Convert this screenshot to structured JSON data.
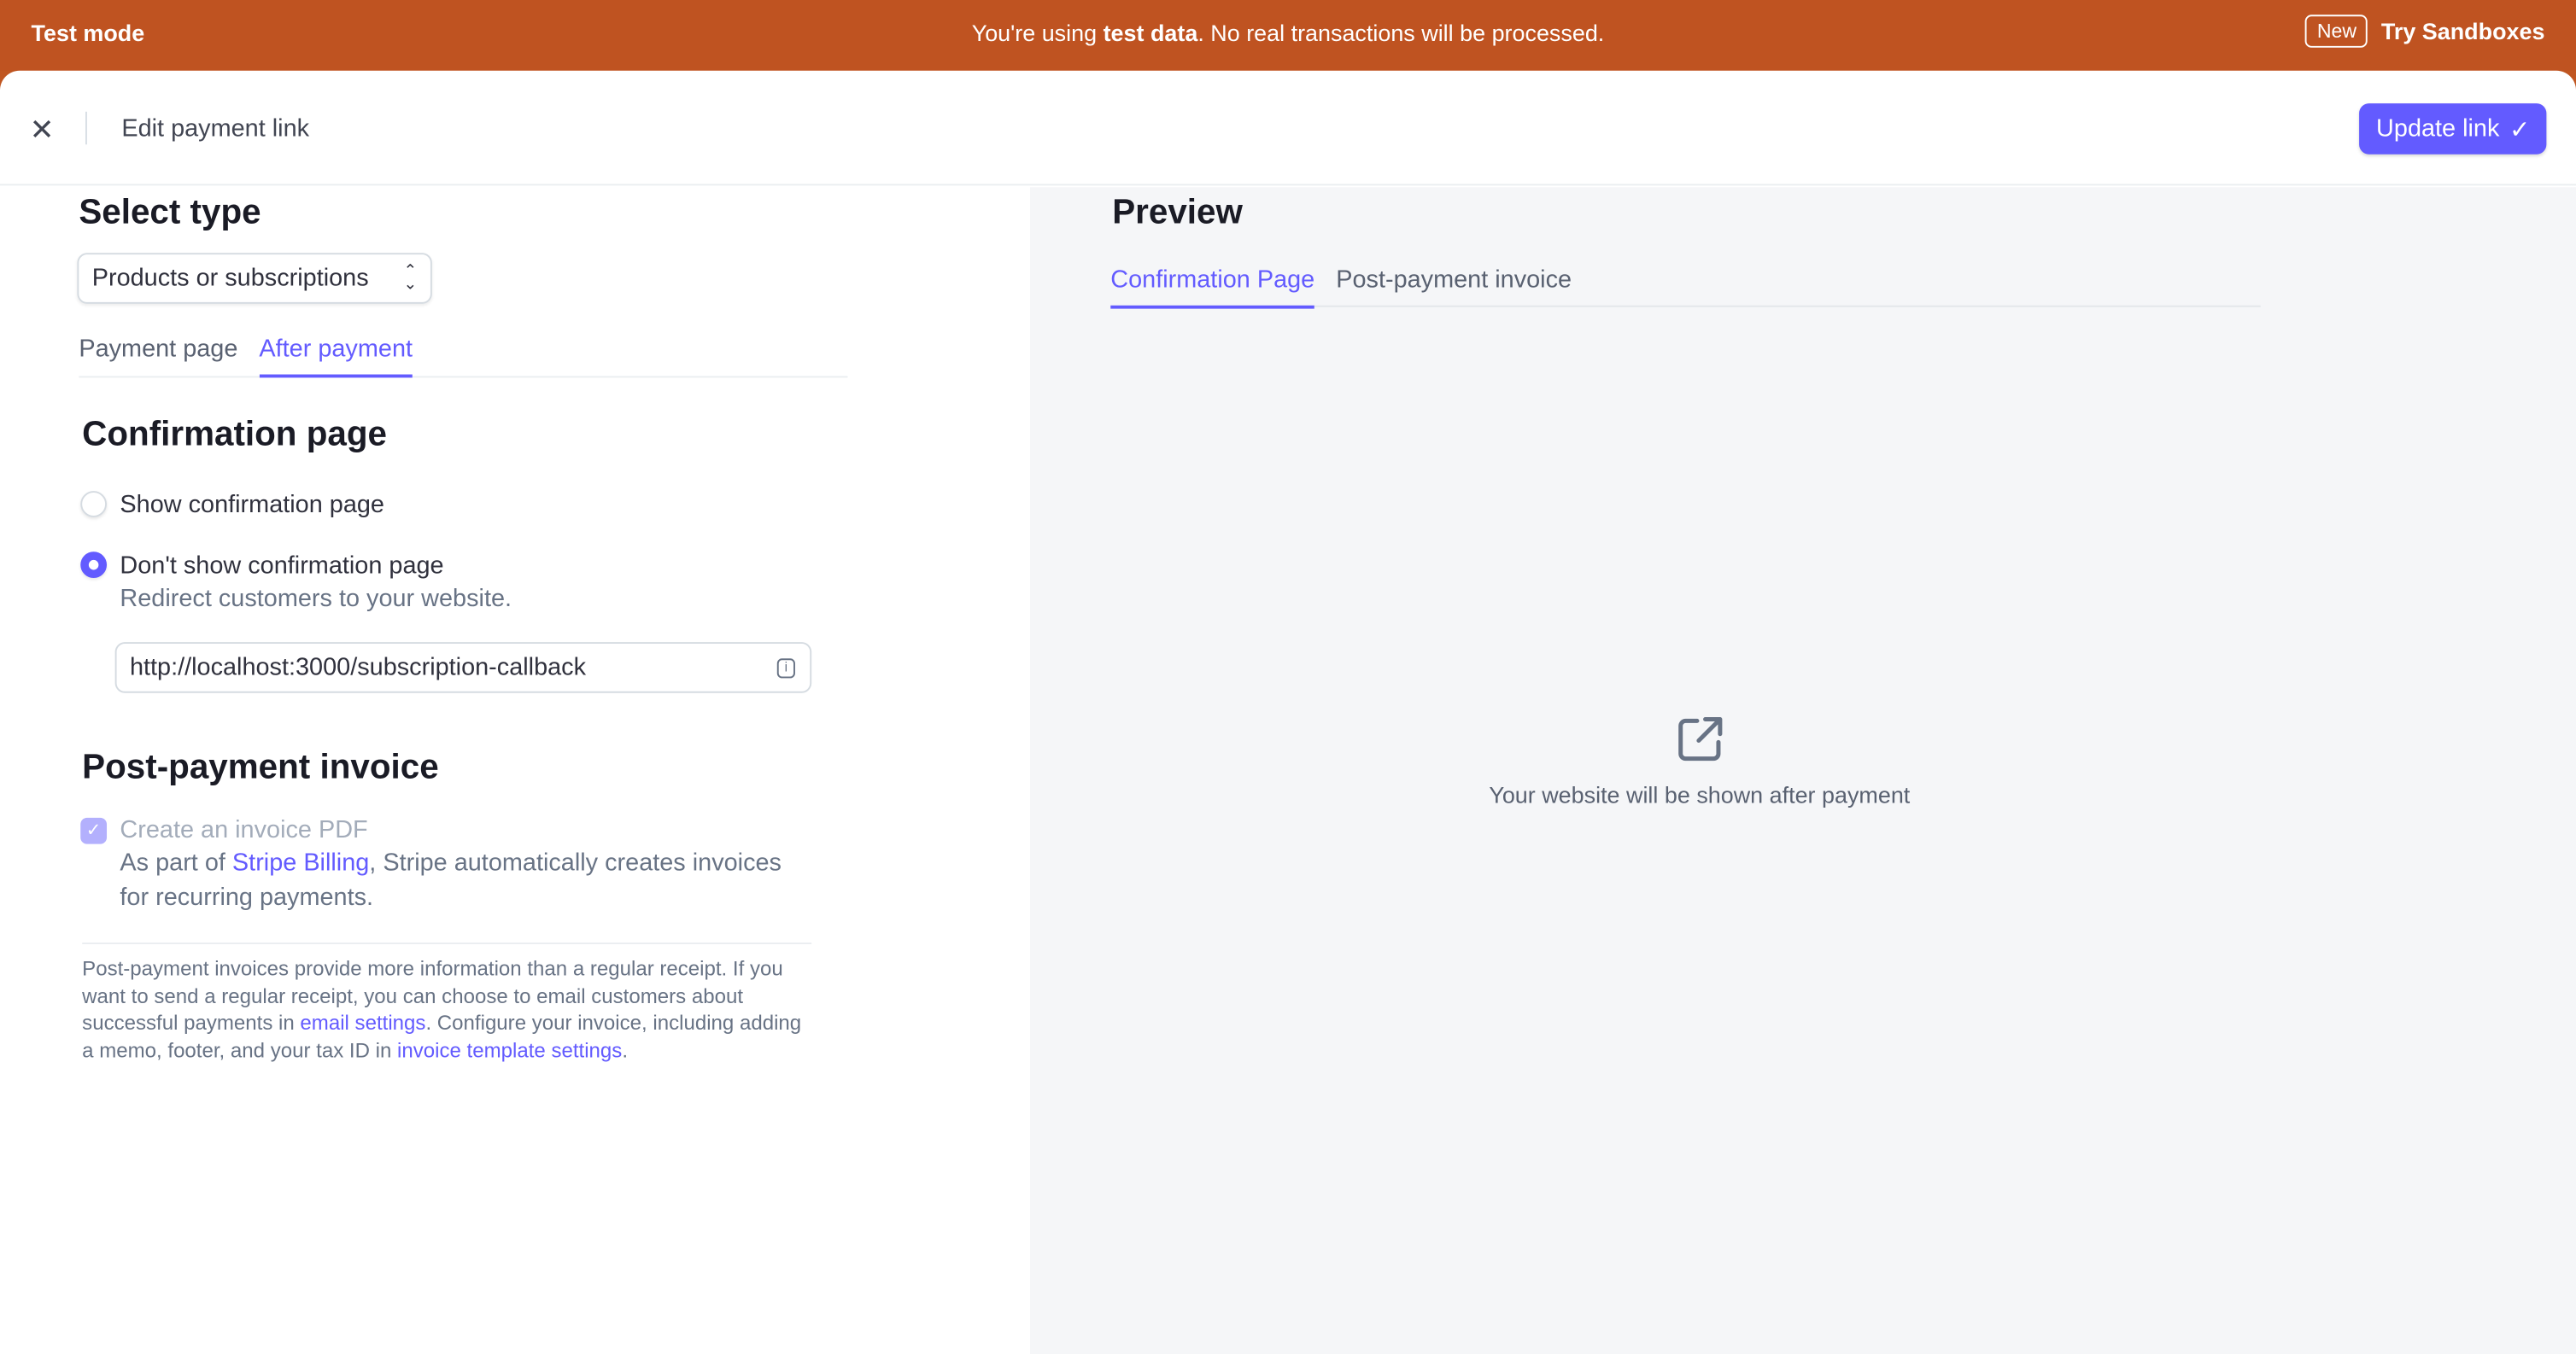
{
  "banner": {
    "mode": "Test mode",
    "message_prefix": "You're using ",
    "message_bold": "test data",
    "message_suffix": ". No real transactions will be processed.",
    "badge": "New",
    "cta": "Try Sandboxes"
  },
  "header": {
    "title": "Edit payment link",
    "update_label": "Update link"
  },
  "left": {
    "select_type_title": "Select type",
    "select_value": "Products or subscriptions",
    "tabs": [
      {
        "label": "Payment page"
      },
      {
        "label": "After payment",
        "active": true
      }
    ],
    "confirmation": {
      "title": "Confirmation page",
      "options": [
        {
          "label": "Show confirmation page",
          "selected": false
        },
        {
          "label": "Don't show confirmation page",
          "selected": true,
          "description": "Redirect customers to your website."
        }
      ],
      "url": "http://localhost:3000/subscription-callback"
    },
    "invoice": {
      "title": "Post-payment invoice",
      "checkbox_label": "Create an invoice PDF",
      "checked": true,
      "desc_prefix": "As part of ",
      "desc_link": "Stripe Billing",
      "desc_suffix": ", Stripe automatically creates invoices for recurring payments.",
      "note_1": "Post-payment invoices provide more information than a regular receipt. If you want to send a regular receipt, you can choose to email customers about successful payments in ",
      "note_link_1": "email settings",
      "note_2": ". Configure your invoice, including adding a memo, footer, and your tax ID in ",
      "note_link_2": "invoice template settings",
      "note_3": "."
    }
  },
  "preview": {
    "title": "Preview",
    "tabs": [
      {
        "label": "Confirmation Page",
        "active": true
      },
      {
        "label": "Post-payment invoice"
      }
    ],
    "message": "Your website will be shown after payment",
    "icon": "external-link-icon"
  },
  "colors": {
    "banner": "#bf5321",
    "accent": "#635bff"
  }
}
